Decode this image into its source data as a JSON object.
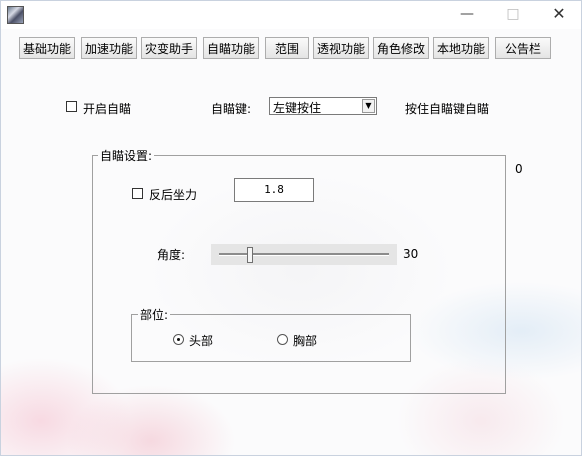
{
  "titlebar": {
    "minimize_icon": "minimize-icon",
    "maximize_icon": "maximize-icon",
    "close_icon": "close-icon"
  },
  "tabs": [
    "基础功能",
    "加速功能",
    "灾变助手",
    "自瞄功能",
    "范围",
    "透视功能",
    "角色修改",
    "本地功能",
    "公告栏"
  ],
  "aim": {
    "enable_label": "开启自瞄",
    "key_label": "自瞄键:",
    "key_value": "左键按住",
    "hint": "按住自瞄键自瞄"
  },
  "settings": {
    "group_title": "自瞄设置:",
    "side_value": "0",
    "recoil_label": "反后坐力",
    "recoil_value": "1.8",
    "angle_label": "角度:",
    "angle_value": "30",
    "angle_level": 30,
    "part_group_title": "部位:",
    "part_head": "头部",
    "part_chest": "胸部",
    "selected_part": "头部"
  }
}
